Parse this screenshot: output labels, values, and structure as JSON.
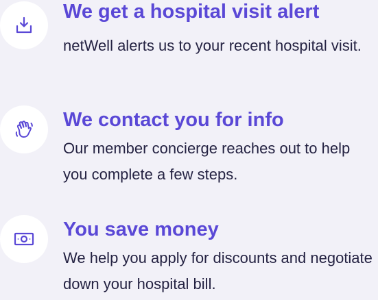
{
  "steps": [
    {
      "icon": "download-tray-icon",
      "title": "We get a hospital visit alert",
      "description": "netWell alerts us to your recent hospital visit."
    },
    {
      "icon": "waving-hand-icon",
      "title": "We contact you for info",
      "description": "Our member concierge reaches out to help you complete a few steps."
    },
    {
      "icon": "cash-icon",
      "title": "You save money",
      "description": "We help you apply for discounts and negotiate down your hospital bill."
    }
  ],
  "colors": {
    "accent": "#5a48d6",
    "text": "#242242",
    "background": "#f2f1f8",
    "icon_circle": "#ffffff"
  }
}
